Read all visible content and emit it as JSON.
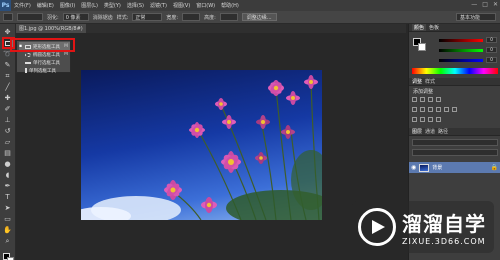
{
  "menubar": {
    "logo": "Ps",
    "items": [
      "文件(F)",
      "编辑(E)",
      "图像(I)",
      "图层(L)",
      "类型(Y)",
      "选择(S)",
      "滤镜(T)",
      "视图(V)",
      "窗口(W)",
      "帮助(H)"
    ],
    "controls": [
      "—",
      "□",
      "✕"
    ]
  },
  "options": {
    "feather_label": "羽化:",
    "feather_value": "0 像素",
    "antialias": "消除锯齿",
    "style_label": "样式:",
    "style_value": "正常",
    "width_label": "宽度:",
    "height_label": "高度:",
    "refine_edge": "调整边缘...",
    "workspace": "基本功能"
  },
  "document": {
    "tab": "图1.jpg @ 100%(RGB/8#)"
  },
  "tool_flyout": {
    "items": [
      {
        "label": "矩形选框工具",
        "key": "M",
        "selected": true
      },
      {
        "label": "椭圆选框工具",
        "key": "M",
        "selected": false
      },
      {
        "label": "单行选框工具",
        "key": "",
        "selected": false
      },
      {
        "label": "单列选框工具",
        "key": "",
        "selected": false
      }
    ]
  },
  "panels": {
    "color_tabs": [
      "颜色",
      "色板"
    ],
    "color_values": [
      "0",
      "0",
      "0"
    ],
    "adjust_tabs": [
      "调整",
      "样式"
    ],
    "adjust_title": "添加调整",
    "layers_tabs": [
      "图层",
      "通道",
      "路径"
    ],
    "layer_name": "背景"
  },
  "watermark": {
    "title": "溜溜自学",
    "url": "ZIXUE.3D66.COM"
  },
  "colors": {
    "menubar": "#3c3c3c",
    "panel": "#3e3e3e",
    "highlight": "#e01414"
  }
}
